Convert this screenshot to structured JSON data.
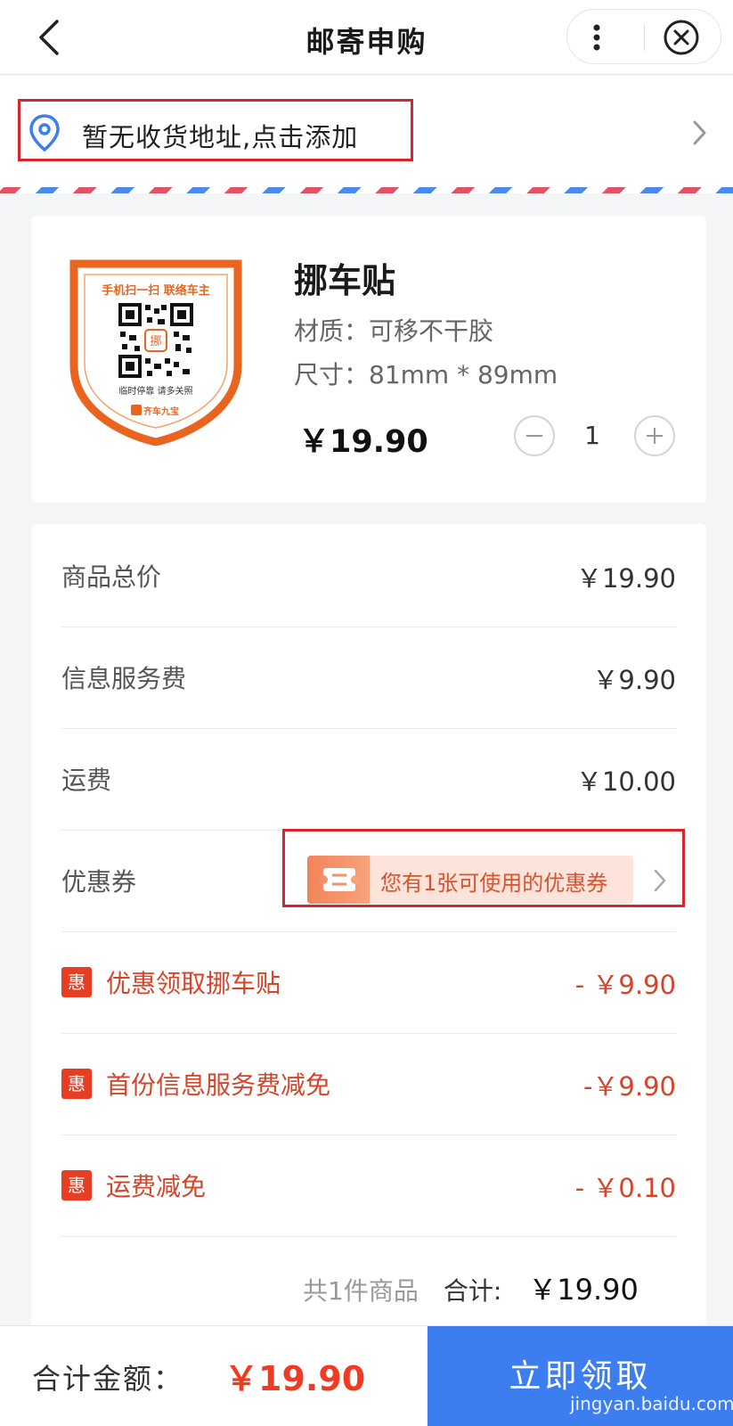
{
  "header": {
    "title": "邮寄申购"
  },
  "address": {
    "placeholder": "暂无收货地址,点击添加"
  },
  "product": {
    "name": "挪车贴",
    "material": "材质：可移不干胶",
    "size": "尺寸：81mm * 89mm",
    "price": "￥19.90",
    "quantity": "1",
    "sticker": {
      "top_text": "手机扫一扫  联络车主",
      "bottom_text": "临时停靠  请多关照",
      "brand": "齐车九宝",
      "qr_center": "挪"
    }
  },
  "fees": {
    "goods_total_label": "商品总价",
    "goods_total_value": "￥19.90",
    "service_fee_label": "信息服务费",
    "service_fee_value": "￥9.90",
    "shipping_label": "运费",
    "shipping_value": "￥10.00",
    "coupon_label": "优惠券",
    "coupon_text": "您有1张可使用的优惠券"
  },
  "discounts": [
    {
      "badge": "惠",
      "label": "优惠领取挪车贴",
      "value": "- ￥9.90"
    },
    {
      "badge": "惠",
      "label": "首份信息服务费减免",
      "value": "-￥9.90"
    },
    {
      "badge": "惠",
      "label": "运费减免",
      "value": "- ￥0.10"
    }
  ],
  "summary": {
    "count": "共1件商品",
    "total_label": "合计:",
    "total_value": "￥19.90"
  },
  "bottom": {
    "total_label": "合计金额：",
    "total_value": "￥19.90",
    "submit_label": "立即领取"
  },
  "watermark": {
    "text": "jingyan.baidu.com"
  },
  "colors": {
    "primary_blue": "#3c7ef0",
    "discount_red": "#d6442a",
    "price_red": "#ef3b24",
    "sticker_orange": "#e9651f",
    "highlight_outline": "#d7252d"
  }
}
